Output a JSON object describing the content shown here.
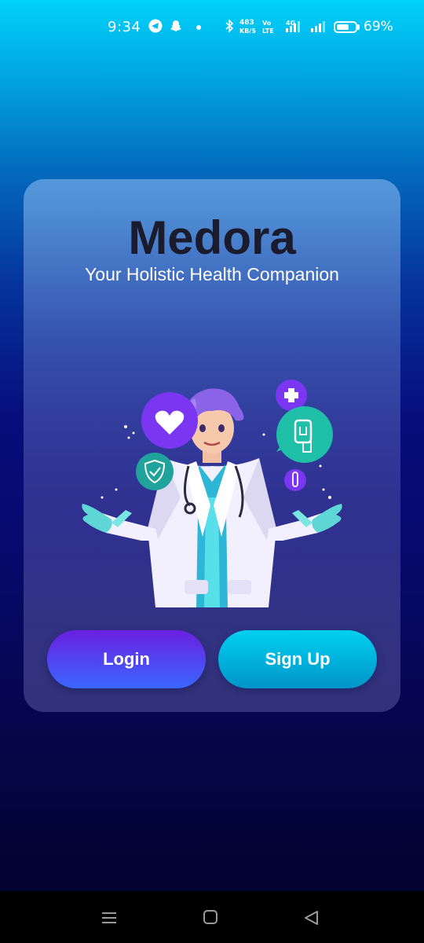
{
  "status_bar": {
    "time": "9:34",
    "net_speed_value": "483",
    "net_speed_unit": "KB/S",
    "volte_top": "Vo",
    "volte_bottom": "LTE",
    "network_type": "4G",
    "battery_percent": "69%",
    "battery_level": 0.69,
    "icons": [
      "telegram-icon",
      "snapchat-icon",
      "notification-dot",
      "bluetooth-icon",
      "signal-icon",
      "signal-icon-2",
      "battery-icon"
    ]
  },
  "app": {
    "title": "Medora",
    "subtitle": "Your Holistic Health Companion"
  },
  "buttons": {
    "login": "Login",
    "signup": "Sign Up"
  },
  "nav_bar": {
    "icons": [
      "menu-icon",
      "home-square-icon",
      "back-triangle-icon"
    ]
  },
  "colors": {
    "accent_purple": "#6a1fe0",
    "accent_blue": "#3a67ff",
    "accent_cyan": "#00c4ec",
    "title_color": "#1b1b2e"
  }
}
